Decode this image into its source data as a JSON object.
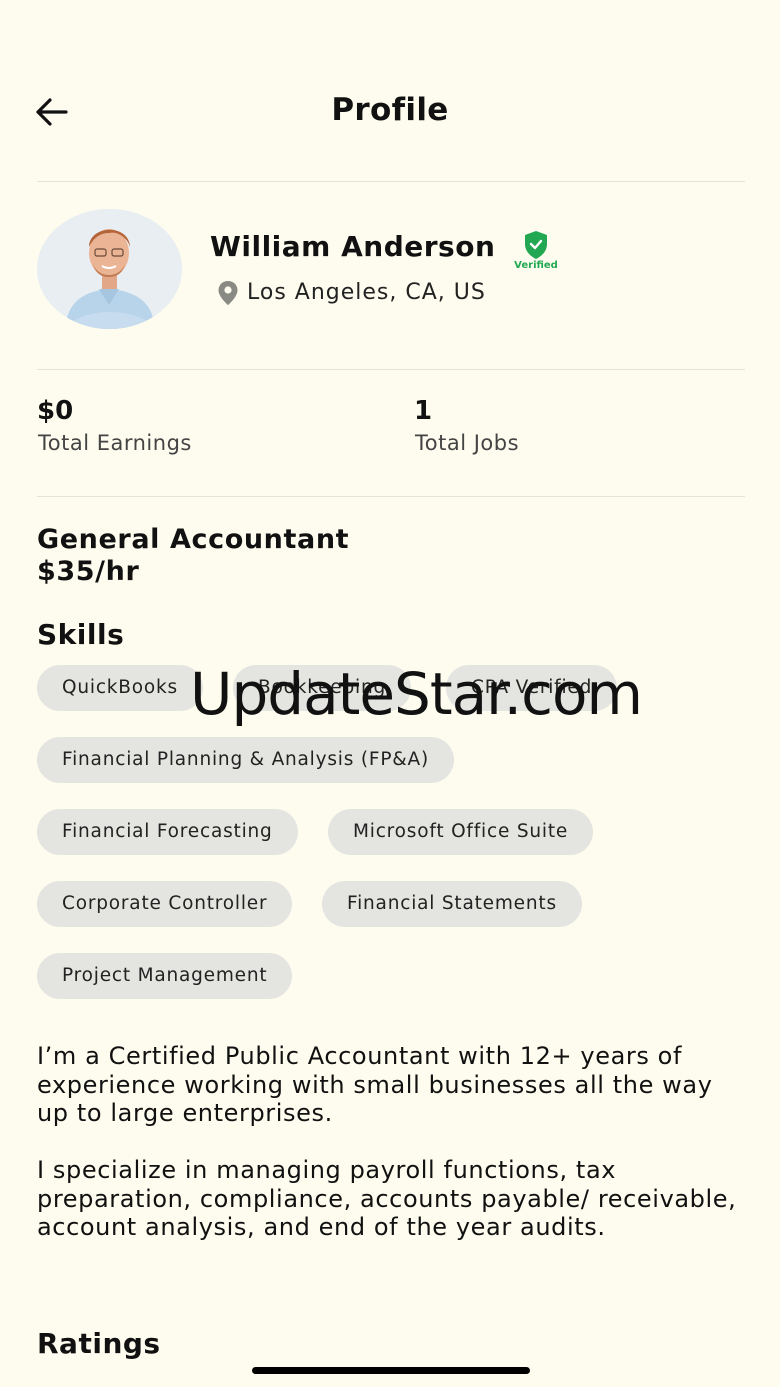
{
  "header": {
    "title": "Profile"
  },
  "profile": {
    "name": "William Anderson",
    "verified_label": "Verified",
    "location": "Los Angeles, CA, US"
  },
  "stats": [
    {
      "value": "$0",
      "label": "Total Earnings"
    },
    {
      "value": "1",
      "label": "Total Jobs"
    }
  ],
  "job": {
    "title": "General Accountant",
    "rate": "$35/hr"
  },
  "skills": {
    "title": "Skills",
    "items": [
      "QuickBooks",
      "Bookkeeping",
      "CPA Verified",
      "Financial Planning & Analysis (FP&A)",
      "Financial Forecasting",
      "Microsoft Office Suite",
      "Corporate Controller",
      "Financial Statements",
      "Project Management"
    ]
  },
  "bio": [
    "I’m a Certified Public Accountant with 12+ years of experience working with small businesses all the way up to large enterprises.",
    "I specialize in managing payroll functions, tax preparation, compliance, accounts payable/ receivable, account analysis, and end of the year audits."
  ],
  "ratings": {
    "title": "Ratings"
  },
  "watermark": "UpdateStar.com",
  "colors": {
    "background": "#fdfcee",
    "chip": "#e4e4e1",
    "verified": "#22a852"
  }
}
